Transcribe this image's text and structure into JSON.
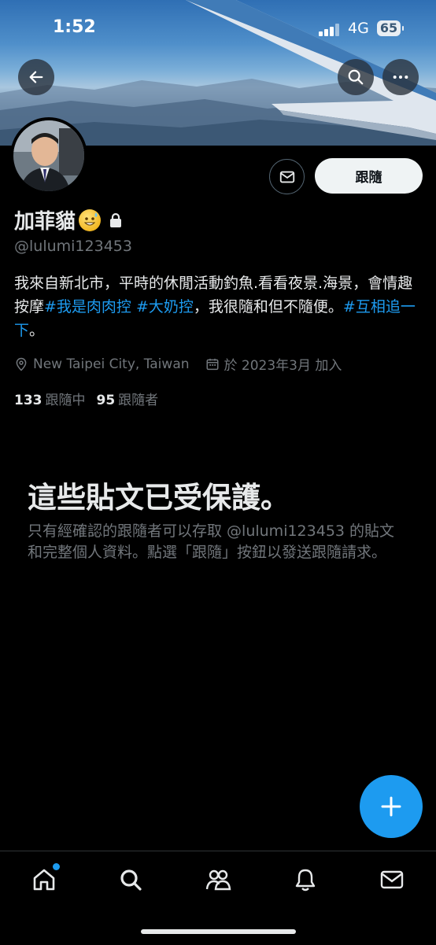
{
  "status_bar": {
    "time": "1:52",
    "network": "4G",
    "battery": "65"
  },
  "profile": {
    "display_name": "加菲貓",
    "handle": "@lulumi123453",
    "bio": {
      "part1": "我來自新北市，平時的休閒活動釣魚.看看夜景.海景，會情趣按摩",
      "tag1": "#我是肉肉控",
      "space": " ",
      "tag2": "#大奶控",
      "part2": "，我很隨和但不隨便。",
      "tag3": "#互相追一下",
      "part3": "。"
    },
    "location": "New Taipei City, Taiwan",
    "joined": "於 2023年3月 加入",
    "following_count": "133",
    "following_label": "跟隨中",
    "followers_count": "95",
    "followers_label": "跟隨者"
  },
  "actions": {
    "follow_label": "跟隨"
  },
  "protected": {
    "title": "這些貼文已受保護。",
    "body": "只有經確認的跟隨者可以存取 @lulumi123453 的貼文和完整個人資料。點選「跟隨」按鈕以發送跟隨請求。"
  },
  "colors": {
    "accent": "#1d9bf0",
    "background": "#000000",
    "muted_text": "#71767b"
  },
  "icons": {
    "back": "back-arrow-icon",
    "search": "search-icon",
    "more": "more-icon",
    "message": "mail-icon",
    "lock": "lock-icon",
    "location": "location-pin-icon",
    "calendar": "calendar-icon",
    "compose": "plus-icon",
    "tabs": [
      "home-icon",
      "search-icon",
      "communities-icon",
      "notifications-icon",
      "messages-icon"
    ]
  }
}
